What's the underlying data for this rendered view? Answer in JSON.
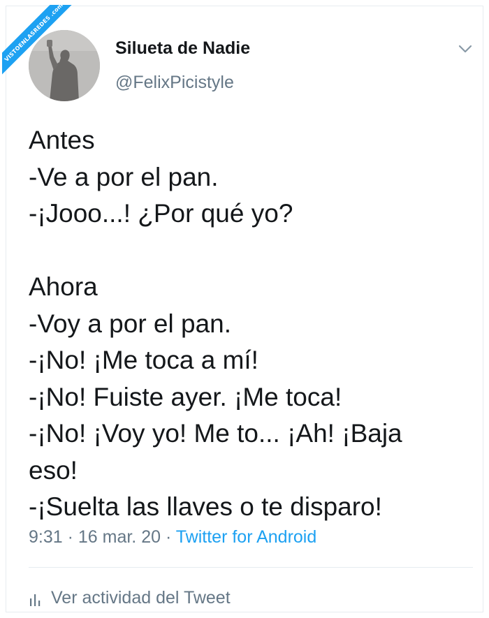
{
  "watermark": {
    "text": "VISTOENLASREDES .com"
  },
  "tweet": {
    "display_name": "Silueta de Nadie",
    "handle": "@FelixPicistyle",
    "text_lines": [
      "Antes",
      "-Ve a por el pan.",
      "-¡Jooo...! ¿Por qué yo?",
      "",
      "Ahora",
      "-Voy a por el pan.",
      "-¡No! ¡Me toca a mí!",
      "-¡No! Fuiste ayer. ¡Me toca!",
      "-¡No! ¡Voy yo! Me to... ¡Ah! ¡Baja",
      "eso!",
      "-¡Suelta las llaves o te disparo!"
    ],
    "timestamp": "9:31 · 16 mar. 20 · ",
    "source": "Twitter for Android",
    "activity_label": "Ver actividad del Tweet"
  },
  "colors": {
    "accent": "#1da1f2",
    "text": "#14171a",
    "muted": "#657786",
    "divider": "#e6ecf0"
  },
  "icons": {
    "menu": "chevron-down-icon",
    "activity": "bar-chart-icon"
  }
}
